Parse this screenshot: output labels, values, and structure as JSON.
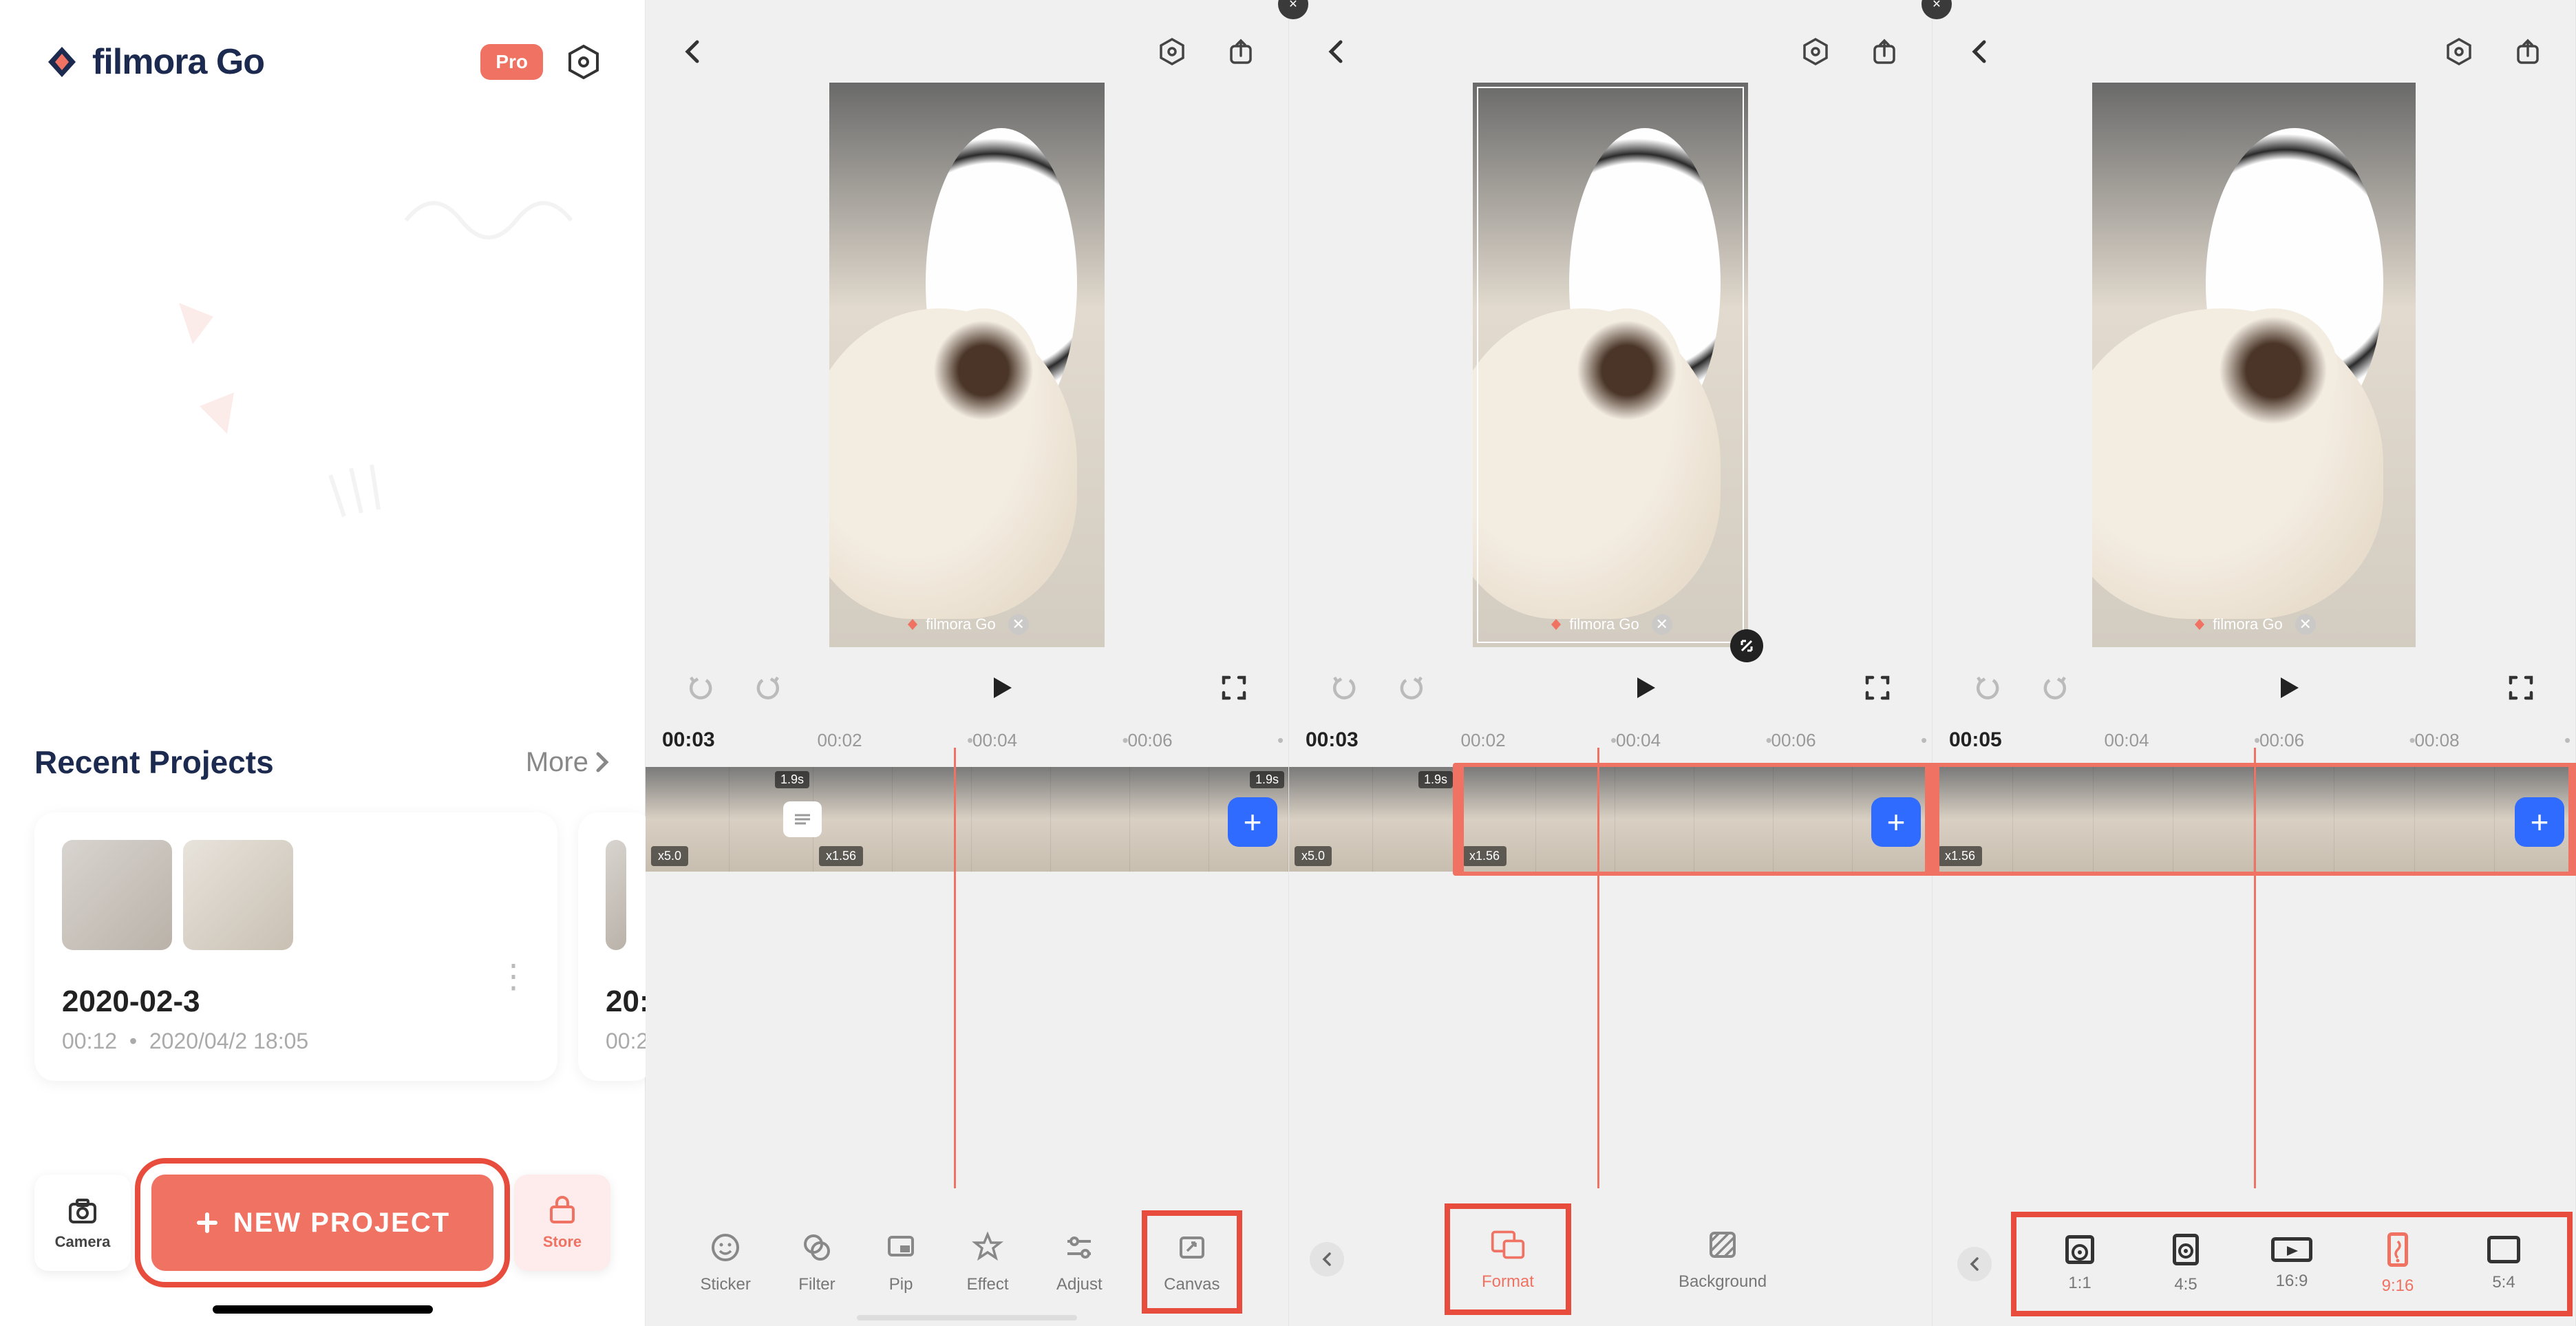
{
  "home": {
    "brand": "filmora Go",
    "pro_label": "Pro",
    "recent_header": "Recent Projects",
    "more_label": "More",
    "project1": {
      "title": "2020-02-3",
      "duration": "00:12",
      "timestamp": "2020/04/2 18:05"
    },
    "project2": {
      "title_peek": "20:",
      "meta_peek": "00:2"
    },
    "camera_label": "Camera",
    "new_project_label": "NEW PROJECT",
    "store_label": "Store"
  },
  "editor_shared": {
    "watermark": "filmora Go",
    "clip1_dur": "1.9s",
    "clip1_speed": "x5.0",
    "clip2_dur": "1.9s",
    "clip2_speed": "x1.56"
  },
  "ed2": {
    "tc_current": "00:03",
    "tc": [
      "00:02",
      "00:04",
      "00:06"
    ],
    "tools": {
      "sticker": "Sticker",
      "filter": "Filter",
      "pip": "Pip",
      "effect": "Effect",
      "adjust": "Adjust",
      "canvas": "Canvas"
    }
  },
  "ed3": {
    "tc_current": "00:03",
    "tc": [
      "00:02",
      "00:04",
      "00:06"
    ],
    "tools": {
      "format": "Format",
      "background": "Background"
    }
  },
  "ed4": {
    "tc_current": "00:05",
    "tc": [
      "00:04",
      "00:06",
      "00:08"
    ],
    "formats": {
      "r11": "1:1",
      "r45": "4:5",
      "r169": "16:9",
      "r916": "9:16",
      "r54": "5:4"
    }
  }
}
